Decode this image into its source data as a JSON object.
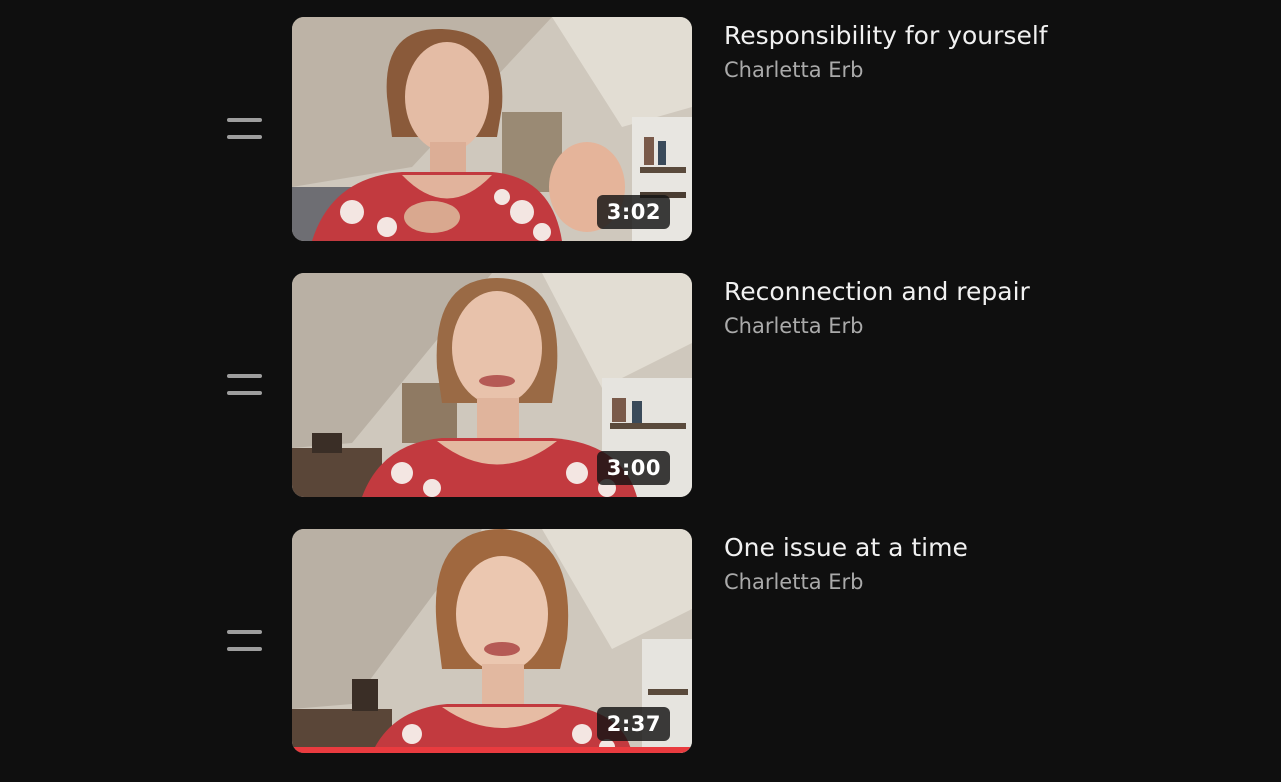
{
  "playlist": {
    "items": [
      {
        "title": "Responsibility for yourself",
        "channel": "Charletta Erb",
        "duration": "3:02",
        "thumbnail": "woman-gesturing-red-patterned-top",
        "watched_fraction": 0
      },
      {
        "title": "Reconnection and repair",
        "channel": "Charletta Erb",
        "duration": "3:00",
        "thumbnail": "woman-smiling-red-patterned-top",
        "watched_fraction": 0
      },
      {
        "title": "One issue at a time",
        "channel": "Charletta Erb",
        "duration": "2:37",
        "thumbnail": "woman-smiling-red-patterned-top",
        "watched_fraction": 1.0
      }
    ]
  },
  "colors": {
    "background": "#0f0f0f",
    "title_text": "#f1f1f1",
    "channel_text": "#aaaaaa",
    "progress_bar": "#e93b3f",
    "drag_handle": "#9e9e9e"
  },
  "icons": {
    "drag_handle": "drag-handle-icon"
  }
}
